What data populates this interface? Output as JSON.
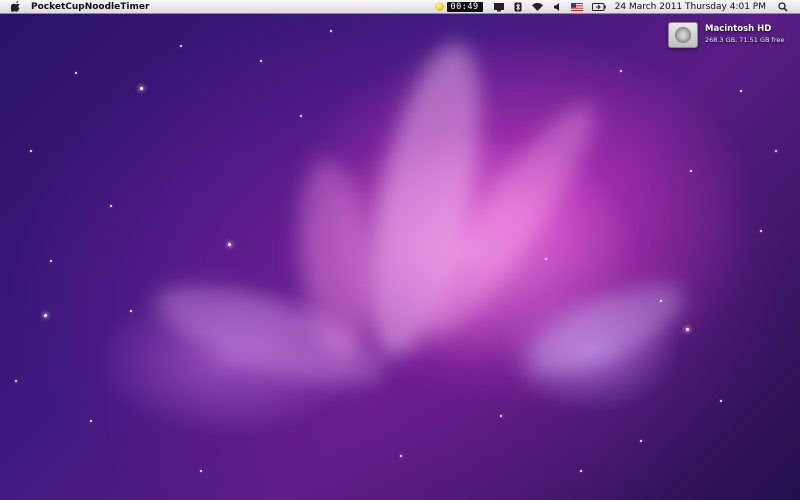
{
  "menubar": {
    "app_name": "PocketCupNoodleTimer",
    "timer_value": "00:49",
    "clock_text": "24 March 2011 Thursday 4:01 PM",
    "icons": [
      "apple-icon",
      "timer-icon",
      "display-icon",
      "bluetooth-icon",
      "wifi-icon",
      "volume-icon",
      "flag-us-icon",
      "battery-icon",
      "spotlight-search-icon"
    ]
  },
  "desktop": {
    "disk_name": "Macintosh HD",
    "disk_info": "268.3 GB, 71.51 GB free"
  }
}
